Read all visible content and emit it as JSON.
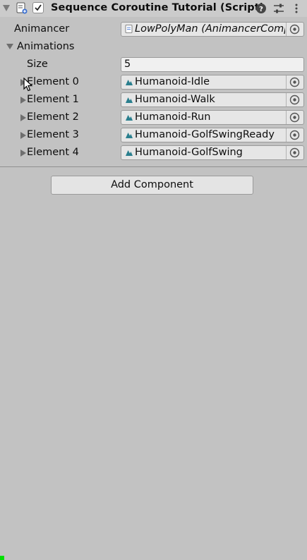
{
  "header": {
    "title": "Sequence Coroutine Tutorial (Script)",
    "enabled": true,
    "icons": [
      "foldout-arrow-icon",
      "script-icon",
      "help-icon",
      "preset-icon",
      "kebab-menu-icon"
    ]
  },
  "fields": {
    "animancer_label": "Animancer",
    "animancer_value": "LowPolyMan (AnimancerComp",
    "animations_label": "Animations",
    "size_label": "Size",
    "size_value": "5"
  },
  "elements": [
    {
      "label": "Element 0",
      "value": "Humanoid-Idle"
    },
    {
      "label": "Element 1",
      "value": "Humanoid-Walk"
    },
    {
      "label": "Element 2",
      "value": "Humanoid-Run"
    },
    {
      "label": "Element 3",
      "value": "Humanoid-GolfSwingReady"
    },
    {
      "label": "Element 4",
      "value": "Humanoid-GolfSwing"
    }
  ],
  "add_component_label": "Add Component",
  "colors": {
    "background": "#c2c2c2",
    "field": "#e6e6e6",
    "clip_icon": "#2a7f8e"
  }
}
